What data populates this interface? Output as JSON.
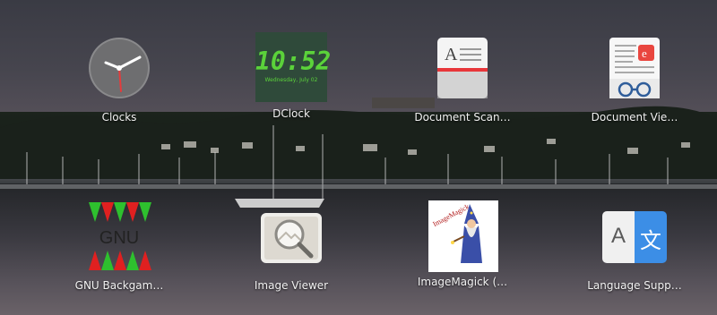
{
  "apps": [
    {
      "label": "Clocks",
      "icon": "clocks-icon"
    },
    {
      "label": "DClock",
      "icon": "dclock-icon",
      "time": "10:52",
      "date": "Wednesday, July 02"
    },
    {
      "label": "Document Scan…",
      "icon": "document-scanner-icon"
    },
    {
      "label": "Document Vie…",
      "icon": "document-viewer-icon"
    },
    {
      "label": "GNU Backgam…",
      "icon": "gnu-backgammon-icon",
      "icon_text": "GNU"
    },
    {
      "label": "Image Viewer",
      "icon": "image-viewer-icon"
    },
    {
      "label": "ImageMagick (…",
      "icon": "imagemagick-icon",
      "icon_text": "ImageMagick"
    },
    {
      "label": "Language Supp…",
      "icon": "language-support-icon",
      "icon_text_left": "A",
      "icon_text_right": "文"
    }
  ],
  "colors": {
    "label_text": "#f2f2f2",
    "dclock_green": "#5bd23a",
    "language_blue": "#3c8ee6"
  }
}
